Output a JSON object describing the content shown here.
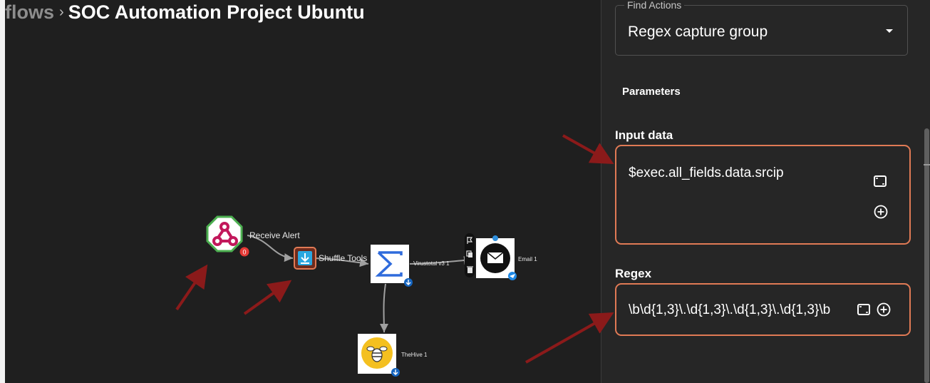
{
  "breadcrumb": {
    "prev": "flows",
    "separator": "›",
    "title": "SOC Automation Project Ubuntu"
  },
  "workflow": {
    "nodes": {
      "receive_alert": {
        "label": "Receive Alert",
        "badge": "0"
      },
      "shuffle_tools": {
        "label": "Shuffle Tools"
      },
      "virustotal": {
        "label": "Virustotal v3 1"
      },
      "email": {
        "label": "Email 1"
      },
      "thehive": {
        "label": "TheHive 1"
      }
    }
  },
  "panel": {
    "find_actions": {
      "legend": "Find Actions",
      "value": "Regex capture group"
    },
    "parameters_heading": "Parameters",
    "input_data": {
      "label": "Input data",
      "value": "$exec.all_fields.data.srcip"
    },
    "regex": {
      "label": "Regex",
      "value": "\\b\\d{1,3}\\.\\d{1,3}\\.\\d{1,3}\\.\\d{1,3}\\b"
    }
  },
  "colors": {
    "canvas_bg": "#1f1f1f",
    "panel_bg": "#262626",
    "field_border": "#e07a55",
    "annotation_arrow": "#8b1a1a"
  }
}
